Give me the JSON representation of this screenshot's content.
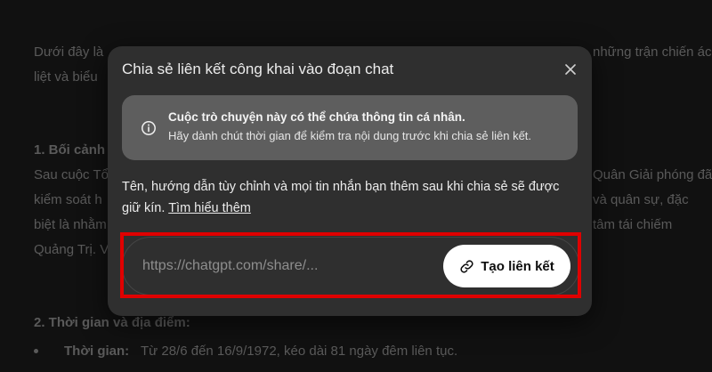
{
  "background": {
    "lines": [
      "Dưới đây là",
      "liệt và biểu",
      "những trận chiến ác",
      "1. Bối cảnh",
      "Sau cuộc Tổ",
      "Quân Giải phóng đã",
      "kiểm soát h",
      "và quân sự, đặc",
      "biệt là nhằm",
      "tâm tái chiếm",
      "Quảng Trị. V",
      "2. Thời gian và địa điểm:",
      "Thời gian:",
      "Từ 28/6 đến 16/9/1972, kéo dài 81 ngày đêm liên tục."
    ]
  },
  "modal": {
    "title": "Chia sẻ liên kết công khai vào đoạn chat",
    "close_icon": "close-icon",
    "notice": {
      "icon": "info-icon",
      "title": "Cuộc trò chuyện này có thể chứa thông tin cá nhân.",
      "text": "Hãy dành chút thời gian để kiểm tra nội dung trước khi chia sẻ liên kết."
    },
    "description": "Tên, hướng dẫn tùy chỉnh và mọi tin nhắn bạn thêm sau khi chia sẻ sẽ được giữ kín.",
    "learn_more": "Tìm hiểu thêm",
    "url_placeholder": "https://chatgpt.com/share/...",
    "create_button": {
      "icon": "link-icon",
      "label": "Tạo liên kết"
    }
  },
  "colors": {
    "highlight": "#e00000",
    "modal_bg": "#2f2f2f",
    "notice_bg": "#5e5e5e"
  }
}
